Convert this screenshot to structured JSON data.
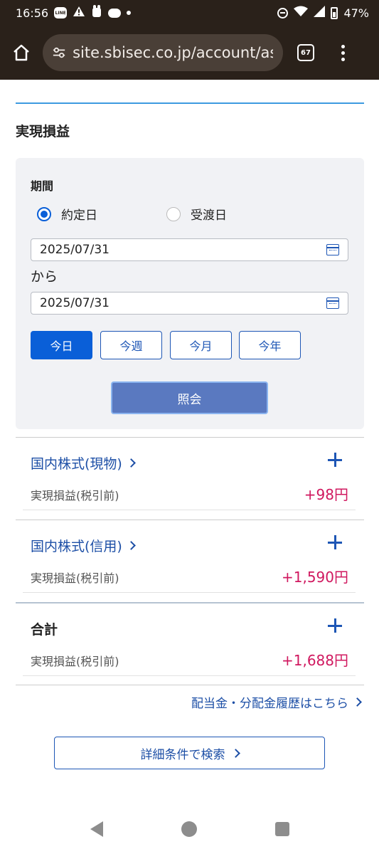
{
  "status_bar": {
    "time": "16:56",
    "line_badge": "LINE",
    "battery_percent": "47%"
  },
  "browser": {
    "url": "site.sbisec.co.jp/account/asse",
    "tab_count": "67"
  },
  "page": {
    "title": "実現損益"
  },
  "filter": {
    "period_label": "期間",
    "radio_options": [
      {
        "label": "約定日",
        "checked": true
      },
      {
        "label": "受渡日",
        "checked": false
      }
    ],
    "date_from": "2025/07/31",
    "separator": "から",
    "date_to": "2025/07/31",
    "quick_buttons": [
      {
        "label": "今日",
        "active": true
      },
      {
        "label": "今週",
        "active": false
      },
      {
        "label": "今月",
        "active": false
      },
      {
        "label": "今年",
        "active": false
      }
    ],
    "submit_label": "照会"
  },
  "sections": [
    {
      "title": "国内株式(現物)",
      "label": "実現損益(税引前)",
      "value": "+98円"
    },
    {
      "title": "国内株式(信用)",
      "label": "実現損益(税引前)",
      "value": "+1,590円"
    },
    {
      "title": "合計",
      "label": "実現損益(税引前)",
      "value": "+1,688円"
    }
  ],
  "links": {
    "dividend_history": "配当金・分配金履歴はこちら",
    "detailed_search": "詳細条件で検索"
  },
  "colors": {
    "accent_blue": "#1d56b5",
    "profit_red": "#d0185f",
    "browser_bg": "#2a211a"
  }
}
